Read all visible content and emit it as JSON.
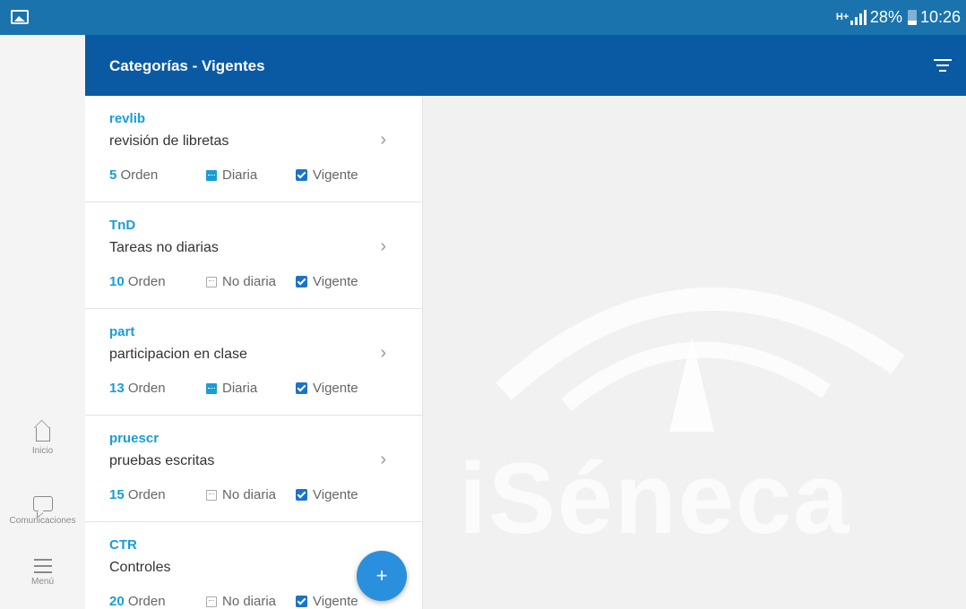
{
  "status_bar": {
    "network": "H+",
    "battery": "28%",
    "time": "10:26"
  },
  "nav_rail": {
    "items": [
      {
        "label": "Inicio",
        "icon": "home-icon"
      },
      {
        "label": "Comunicaciones",
        "icon": "chat-icon"
      },
      {
        "label": "Menú",
        "icon": "menu-icon"
      }
    ]
  },
  "header": {
    "title": "Categorías - Vigentes",
    "filter_icon": "filter-icon"
  },
  "categories": [
    {
      "code": "revlib",
      "description": "revisión de libretas",
      "order": "5",
      "order_label": "Orden",
      "frequency": "Diaria",
      "frequency_active": true,
      "status": "Vigente"
    },
    {
      "code": "TnD",
      "description": "Tareas no diarias",
      "order": "10",
      "order_label": "Orden",
      "frequency": "No diaria",
      "frequency_active": false,
      "status": "Vigente"
    },
    {
      "code": "part",
      "description": "participacion en clase",
      "order": "13",
      "order_label": "Orden",
      "frequency": "Diaria",
      "frequency_active": true,
      "status": "Vigente"
    },
    {
      "code": "pruescr",
      "description": "pruebas escritas",
      "order": "15",
      "order_label": "Orden",
      "frequency": "No diaria",
      "frequency_active": false,
      "status": "Vigente"
    },
    {
      "code": "CTR",
      "description": "Controles",
      "order": "20",
      "order_label": "Orden",
      "frequency": "No diaria",
      "frequency_active": false,
      "status": "Vigente"
    }
  ],
  "fab": {
    "label": "+"
  },
  "watermark": {
    "text": "iSéneca"
  },
  "colors": {
    "status_bar": "#1a73ad",
    "header": "#0a5aa3",
    "accent": "#1a9cd6",
    "fab": "#2a8fdc"
  }
}
